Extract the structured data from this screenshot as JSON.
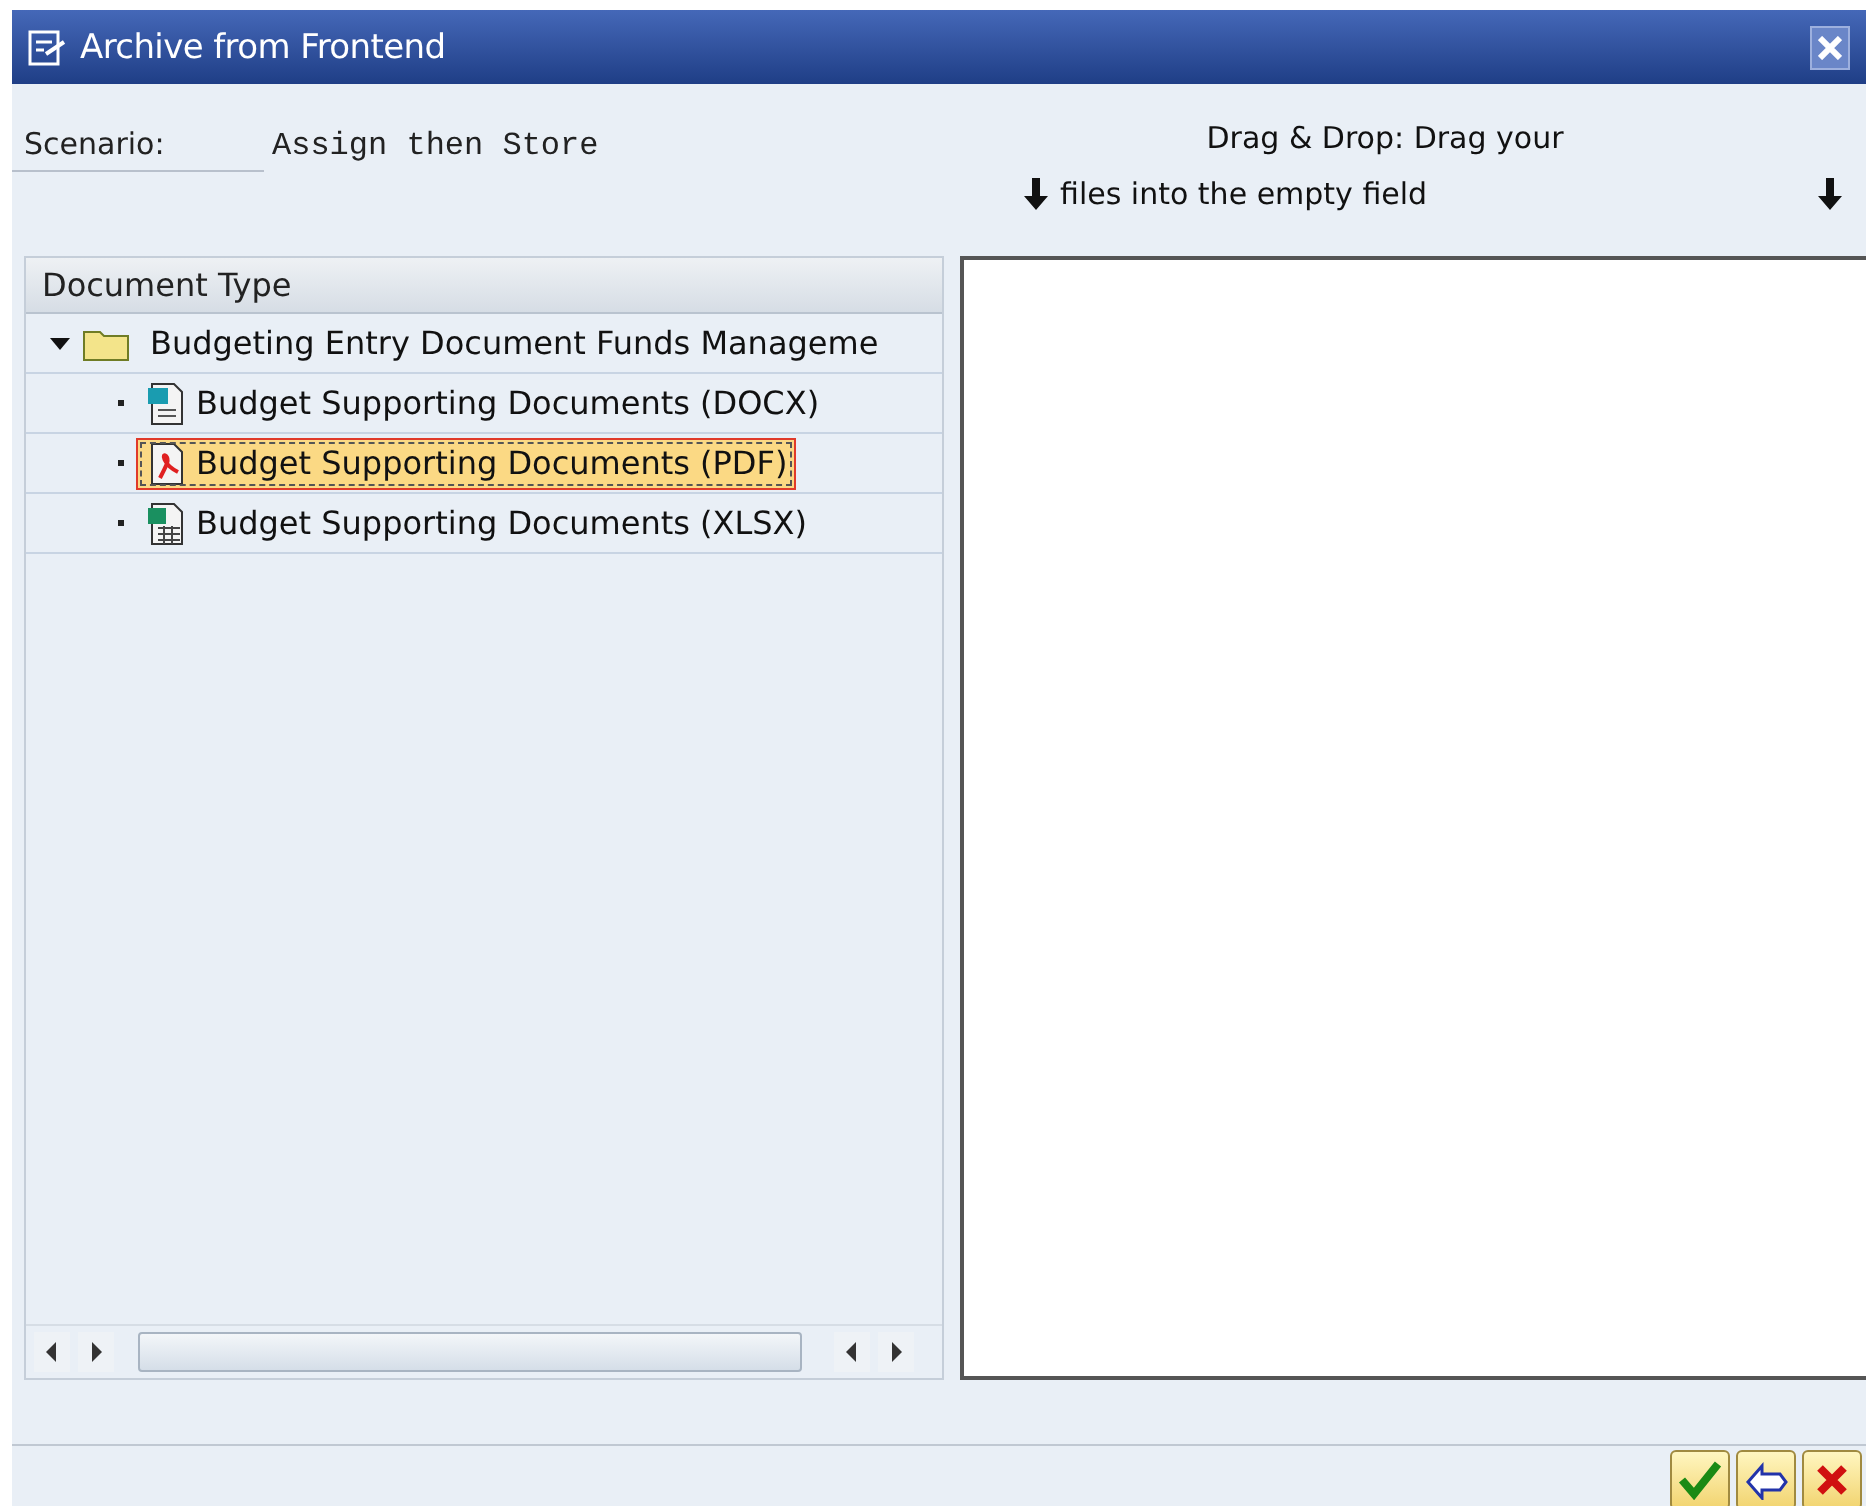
{
  "window": {
    "title": "Archive from Frontend"
  },
  "scenario": {
    "label": "Scenario:",
    "value": "Assign then Store"
  },
  "drop_hint": {
    "line_1": "Drag & Drop: Drag your",
    "line_2": "files into the empty field"
  },
  "tree": {
    "header": "Document Type",
    "items": [
      {
        "label": "Budgeting Entry Document Funds Manageme",
        "kind": "folder",
        "expanded": true,
        "selected": false,
        "children": [
          {
            "label": "Budget Supporting Documents (DOCX)",
            "kind": "word",
            "selected": false
          },
          {
            "label": "Budget Supporting Documents (PDF)",
            "kind": "pdf",
            "selected": true
          },
          {
            "label": "Budget Supporting Documents (XLSX)",
            "kind": "excel",
            "selected": false
          }
        ]
      }
    ]
  },
  "buttons": [
    {
      "kind": "confirm"
    },
    {
      "kind": "undo"
    },
    {
      "kind": "cancel"
    }
  ]
}
